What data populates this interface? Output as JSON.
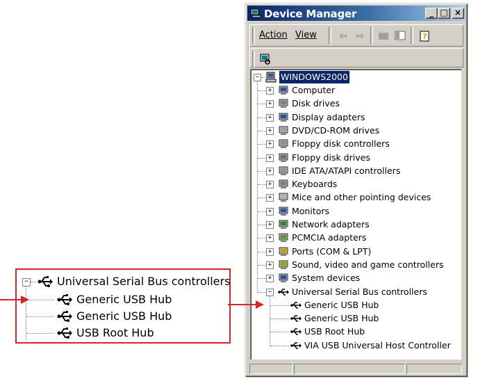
{
  "window": {
    "title": "Device Manager"
  },
  "menu": {
    "action": "Action",
    "view": "View"
  },
  "tree": {
    "root": "WINDOWS2000",
    "categories": [
      {
        "label": "Computer",
        "icon": "computer-icon"
      },
      {
        "label": "Disk drives",
        "icon": "disk-drive-icon"
      },
      {
        "label": "Display adapters",
        "icon": "display-adapter-icon"
      },
      {
        "label": "DVD/CD-ROM drives",
        "icon": "dvd-drive-icon"
      },
      {
        "label": "Floppy disk controllers",
        "icon": "floppy-controller-icon"
      },
      {
        "label": "Floppy disk drives",
        "icon": "floppy-drive-icon"
      },
      {
        "label": "IDE ATA/ATAPI controllers",
        "icon": "ide-controller-icon"
      },
      {
        "label": "Keyboards",
        "icon": "keyboard-icon"
      },
      {
        "label": "Mice and other pointing devices",
        "icon": "mouse-icon"
      },
      {
        "label": "Monitors",
        "icon": "monitor-icon"
      },
      {
        "label": "Network adapters",
        "icon": "network-adapter-icon"
      },
      {
        "label": "PCMCIA adapters",
        "icon": "pcmcia-icon"
      },
      {
        "label": "Ports (COM & LPT)",
        "icon": "port-icon"
      },
      {
        "label": "Sound, video and game controllers",
        "icon": "sound-icon"
      },
      {
        "label": "System devices",
        "icon": "system-device-icon"
      },
      {
        "label": "Universal Serial Bus controllers",
        "icon": "usb-icon"
      }
    ],
    "usb_children": [
      "Generic USB Hub",
      "Generic USB Hub",
      "USB Root Hub",
      "VIA USB Universal Host Controller"
    ]
  },
  "callout": {
    "header": "Universal Serial Bus controllers",
    "items": [
      "Generic USB Hub",
      "Generic USB Hub",
      "USB Root Hub"
    ]
  },
  "colors": {
    "accent": "#d8232a",
    "title_bar": "#0a246a",
    "selection": "#0a246a"
  }
}
